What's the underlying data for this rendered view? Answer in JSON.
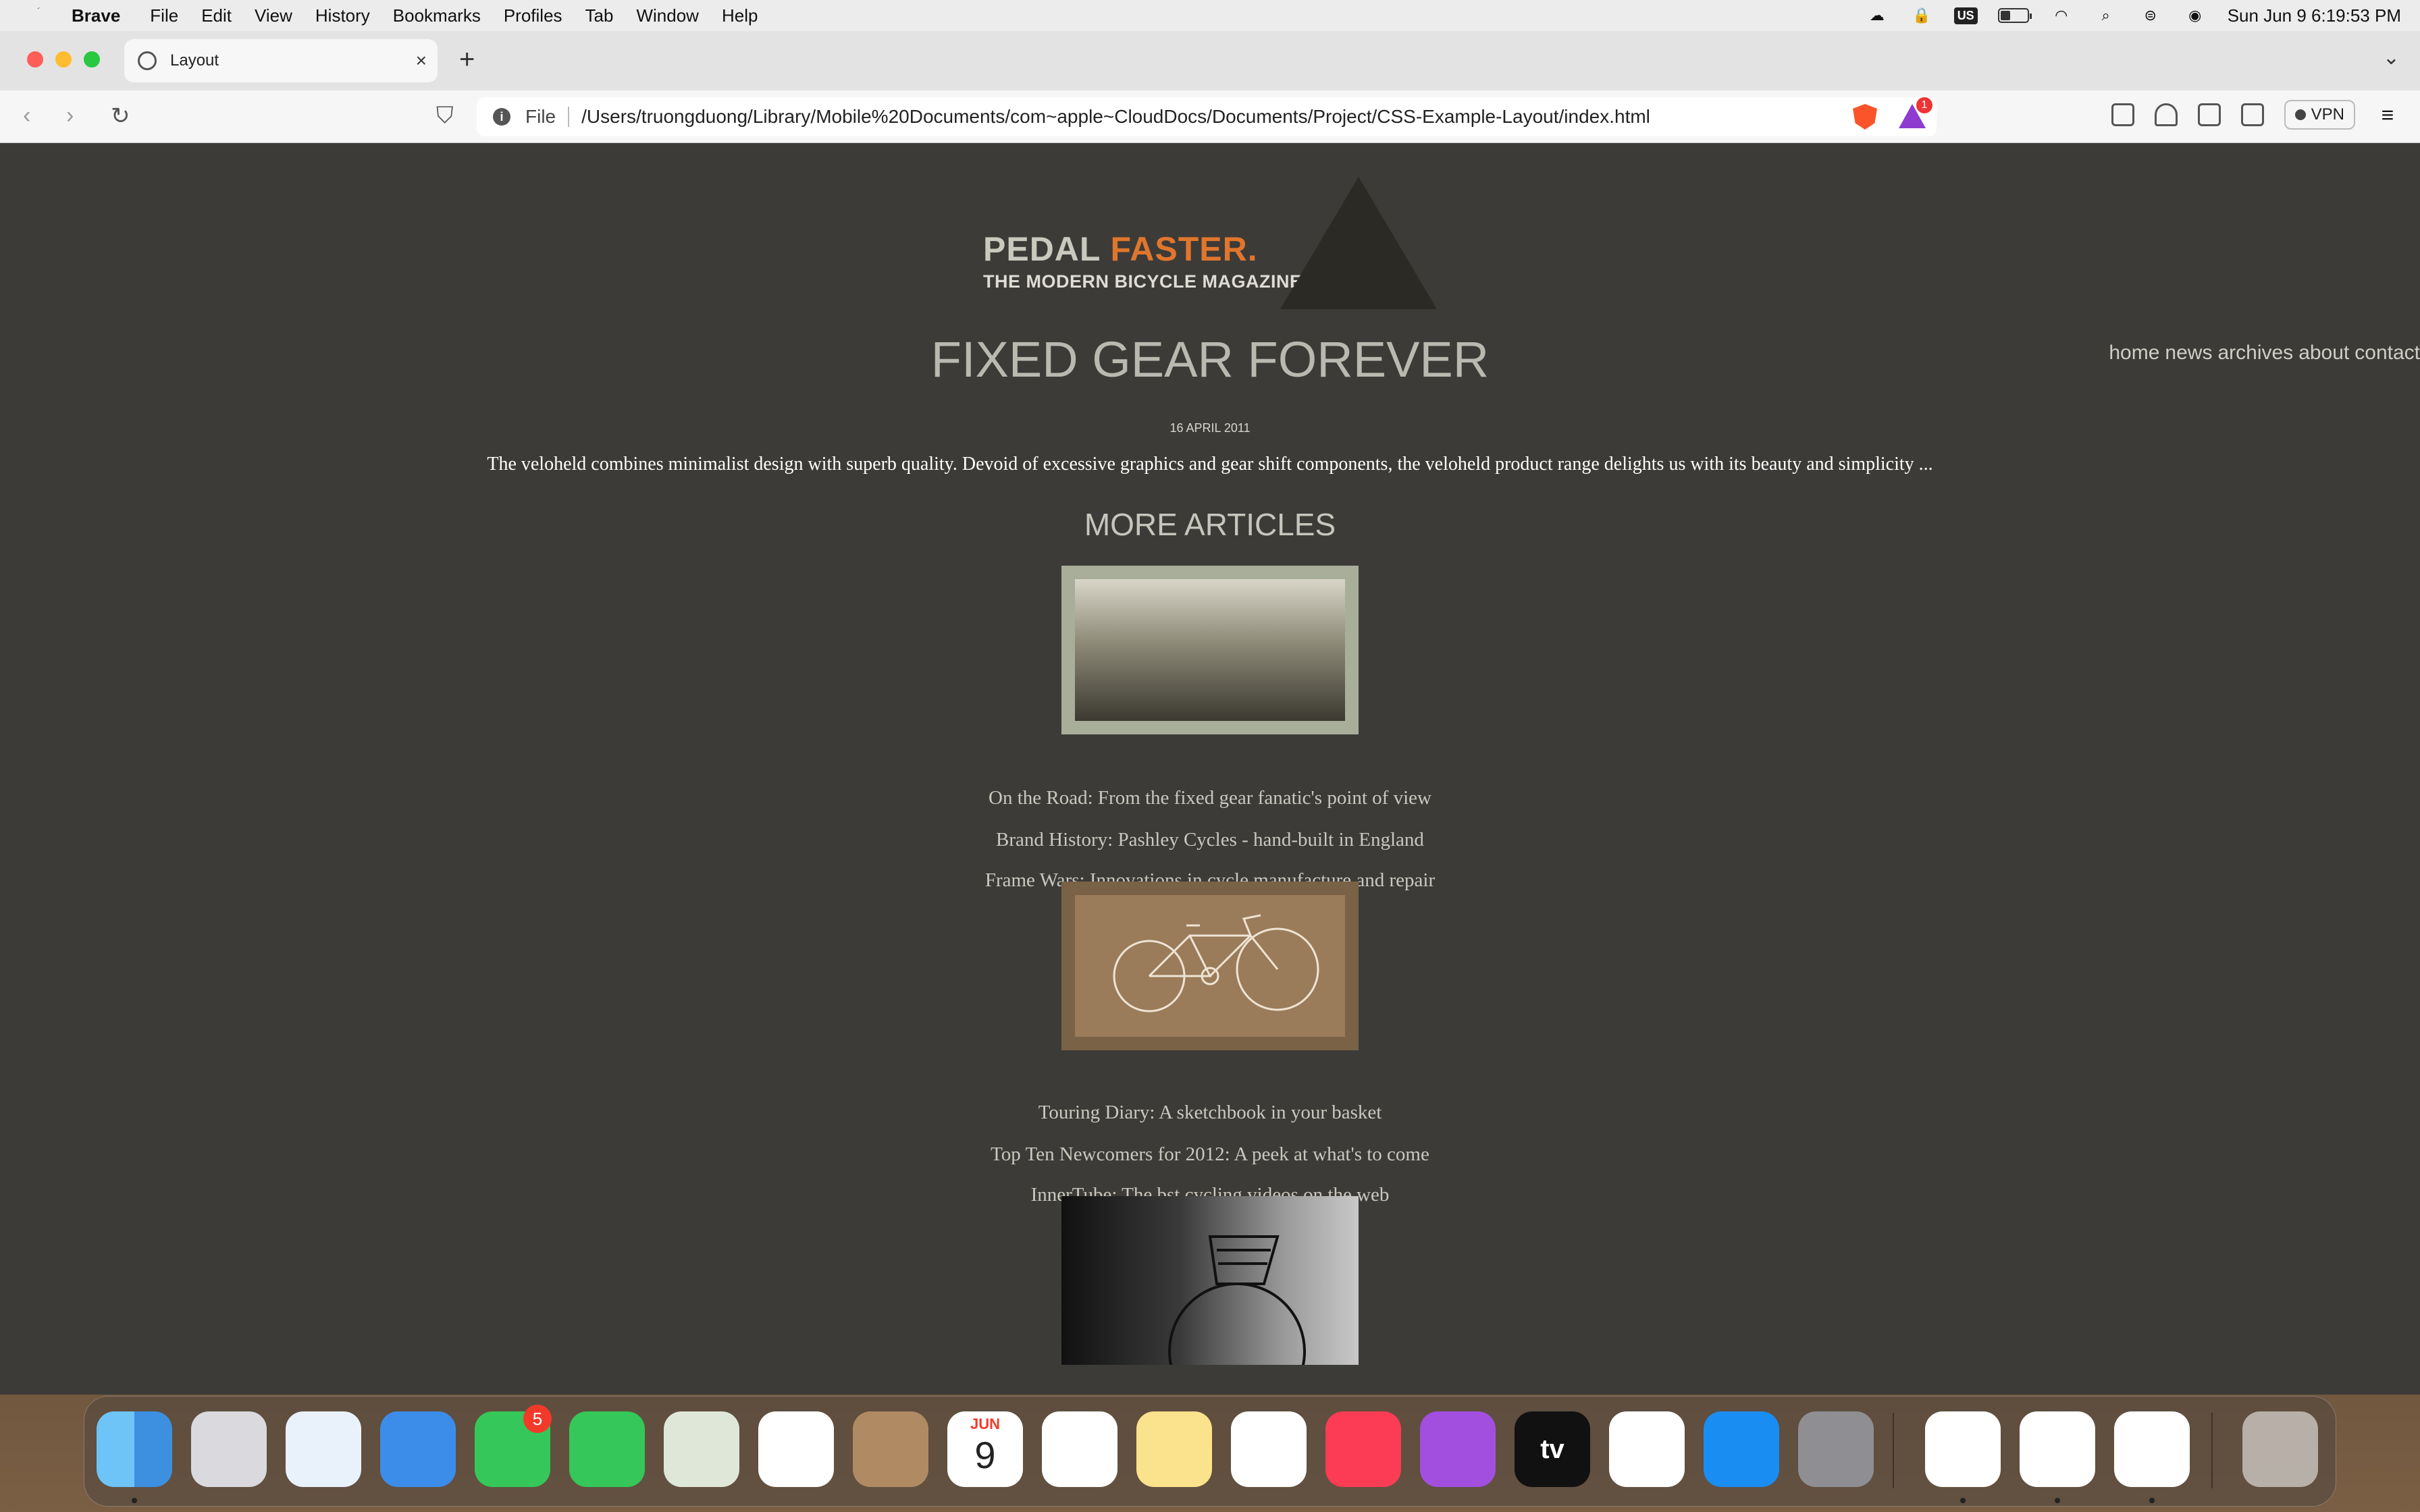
{
  "menubar": {
    "app": "Brave",
    "items": [
      "File",
      "Edit",
      "View",
      "History",
      "Bookmarks",
      "Profiles",
      "Tab",
      "Window",
      "Help"
    ],
    "keyboard_badge": "US",
    "clock": "Sun Jun 9  6:19:53 PM",
    "icons": [
      "cloud-icon",
      "lock-icon",
      "keyboard-icon",
      "battery-icon",
      "wifi-icon",
      "search-icon",
      "control-center-icon",
      "siri-icon"
    ]
  },
  "browser": {
    "tab_title": "Layout",
    "tab_close": "×",
    "new_tab": "+",
    "url_scheme_label": "File",
    "url": "/Users/truongduong/Library/Mobile%20Documents/com~apple~CloudDocs/Documents/Project/CSS-Example-Layout/index.html",
    "rewards_badge": "1",
    "vpn_label": "VPN"
  },
  "page": {
    "logo_main": "PEDAL ",
    "logo_accent": "FASTER.",
    "logo_sub": "THE MODERN BICYCLE MAGAZINE",
    "nav": [
      "home",
      "news",
      "archives",
      "about",
      "contact"
    ],
    "headline": "FIXED GEAR FOREVER",
    "date": "16 APRIL 2011",
    "summary": "The veloheld combines minimalist design with superb quality. Devoid of excessive graphics and gear shift components, the veloheld product range delights us with its beauty and simplicity ...",
    "more_heading": "MORE ARTICLES",
    "articles": [
      "On the Road: From the fixed gear fanatic's point of view",
      "Brand History: Pashley Cycles - hand-built in England",
      "Frame Wars: Innovations in cycle manufacture and repair",
      "Touring Diary: A sketchbook in your basket",
      "Top Ten Newcomers for 2012: A peek at what's to come",
      "InnerTube: The bst cycling videos on the web"
    ]
  },
  "dock": {
    "apps": [
      "finder",
      "launchpad",
      "safari",
      "mail",
      "facetime",
      "messages",
      "maps",
      "photos",
      "contacts",
      "calendar",
      "reminders",
      "notes",
      "freeform",
      "music",
      "podcasts",
      "tv",
      "news",
      "app-store",
      "system-settings",
      "chrome",
      "vscode",
      "brave",
      "trash"
    ],
    "facetime_badge": "5",
    "calendar_month": "JUN",
    "calendar_day": "9",
    "tv_label": "tv"
  },
  "colors": {
    "page_bg": "#3d3b38",
    "logo_accent": "#e0762e",
    "close": "#ff5f57",
    "minimize": "#febc2e",
    "zoom": "#28c840"
  }
}
